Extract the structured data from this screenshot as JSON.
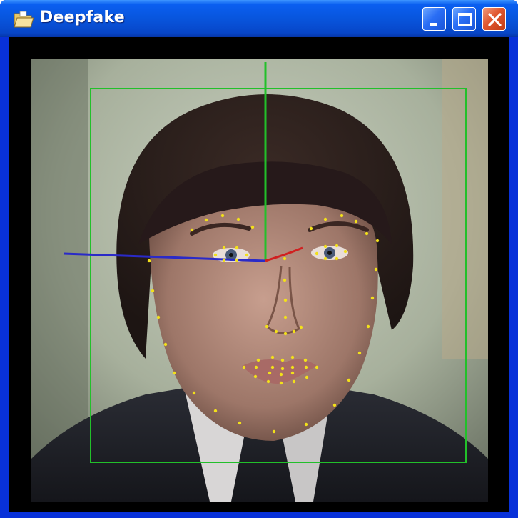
{
  "window": {
    "title": "Deepfake",
    "title_icon": "folder-icon",
    "controls": {
      "minimize_icon": "minimize-icon",
      "maximize_icon": "maximize-icon",
      "close_icon": "close-icon"
    }
  },
  "video": {
    "overlay": {
      "box_color": "#22c02a",
      "landmark_color": "#f2e01a",
      "axis_colors": {
        "yaw": "#2a2ac8",
        "roll": "#d02020",
        "pitch": "#22c02a"
      }
    }
  },
  "colors": {
    "title_bar": "#0855dd",
    "window_border": "#0831d9",
    "client_background": "#000000",
    "close_button": "#e0572f"
  }
}
